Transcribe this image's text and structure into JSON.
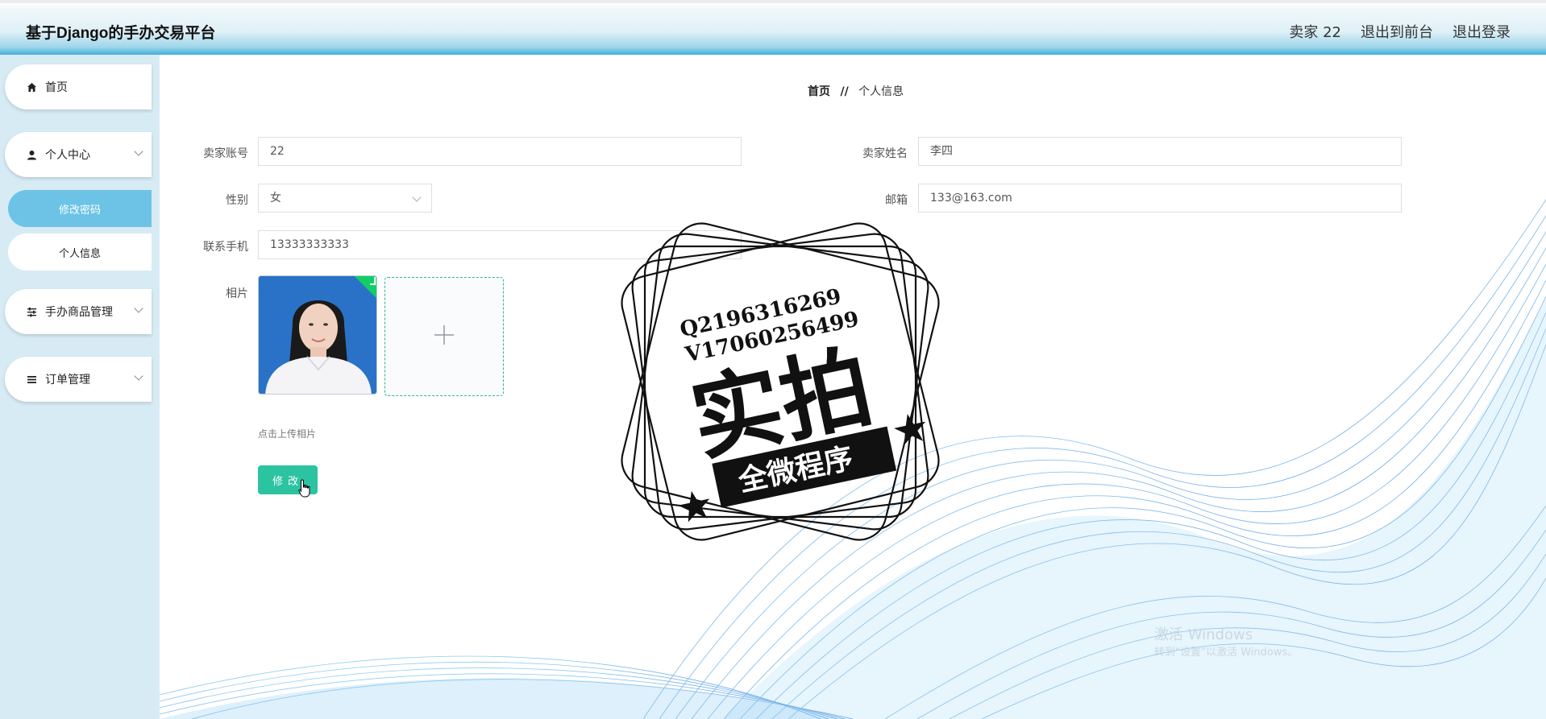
{
  "header": {
    "app_title": "基于Django的手办交易平台",
    "user_label": "卖家 22",
    "to_front": "退出到前台",
    "logout": "退出登录"
  },
  "sidebar": {
    "items": [
      {
        "label": "首页",
        "icon": "home-icon"
      },
      {
        "label": "个人中心",
        "icon": "user-icon"
      },
      {
        "label": "手办商品管理",
        "icon": "sliders-icon"
      },
      {
        "label": "订单管理",
        "icon": "list-icon"
      }
    ],
    "sub_items": [
      {
        "label": "修改密码",
        "active": true
      },
      {
        "label": "个人信息",
        "active": false
      }
    ]
  },
  "breadcrumb": {
    "home": "首页",
    "separator": "//",
    "current": "个人信息"
  },
  "form": {
    "account_label": "卖家账号",
    "account_value": "22",
    "name_label": "卖家姓名",
    "name_value": "李四",
    "gender_label": "性别",
    "gender_value": "女",
    "email_label": "邮箱",
    "email_value": "133@163.com",
    "phone_label": "联系手机",
    "phone_value": "13333333333",
    "photo_label": "相片",
    "upload_hint": "点击上传相片",
    "submit_label": "修改"
  },
  "stamp": {
    "line1": "Q2196316269",
    "line2": "V17060256499",
    "big_text": "实拍",
    "ribbon_text": "全微程序"
  },
  "os_watermark": {
    "line1": "激活 Windows",
    "line2": "转到\"设置\"以激活 Windows。"
  },
  "colors": {
    "accent": "#2cc3a1",
    "sidebar_bg": "#d7ebf5",
    "active_sub": "#6cc3e6",
    "header_bottom": "#3fb0d8"
  }
}
